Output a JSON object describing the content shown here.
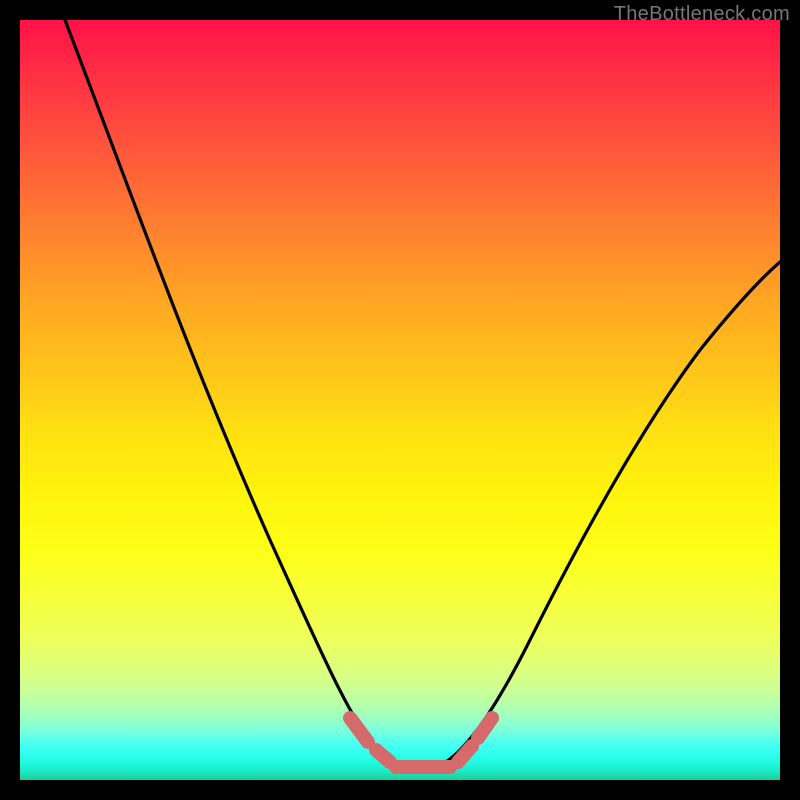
{
  "watermark": "TheBottleneck.com",
  "chart_data": {
    "type": "line",
    "title": "",
    "xlabel": "",
    "ylabel": "",
    "xlim": [
      0,
      100
    ],
    "ylim": [
      0,
      100
    ],
    "series": [
      {
        "name": "bottleneck-curve",
        "x": [
          0,
          6,
          12,
          18,
          24,
          30,
          36,
          40,
          44,
          47,
          50,
          53,
          56,
          60,
          66,
          72,
          78,
          84,
          90,
          96,
          100
        ],
        "y": [
          100,
          88,
          76,
          64,
          52,
          40,
          28,
          18,
          10,
          5,
          3,
          3,
          5,
          10,
          20,
          32,
          44,
          54,
          62,
          67,
          69
        ]
      }
    ],
    "annotations": [
      {
        "name": "valley-marker",
        "type": "segmented-line",
        "color": "#d46a6a"
      }
    ],
    "background_gradient": {
      "top": "#ff1247",
      "mid_upper": "#ffaa22",
      "mid_lower": "#fdff18",
      "bottom": "#18cf98"
    }
  }
}
